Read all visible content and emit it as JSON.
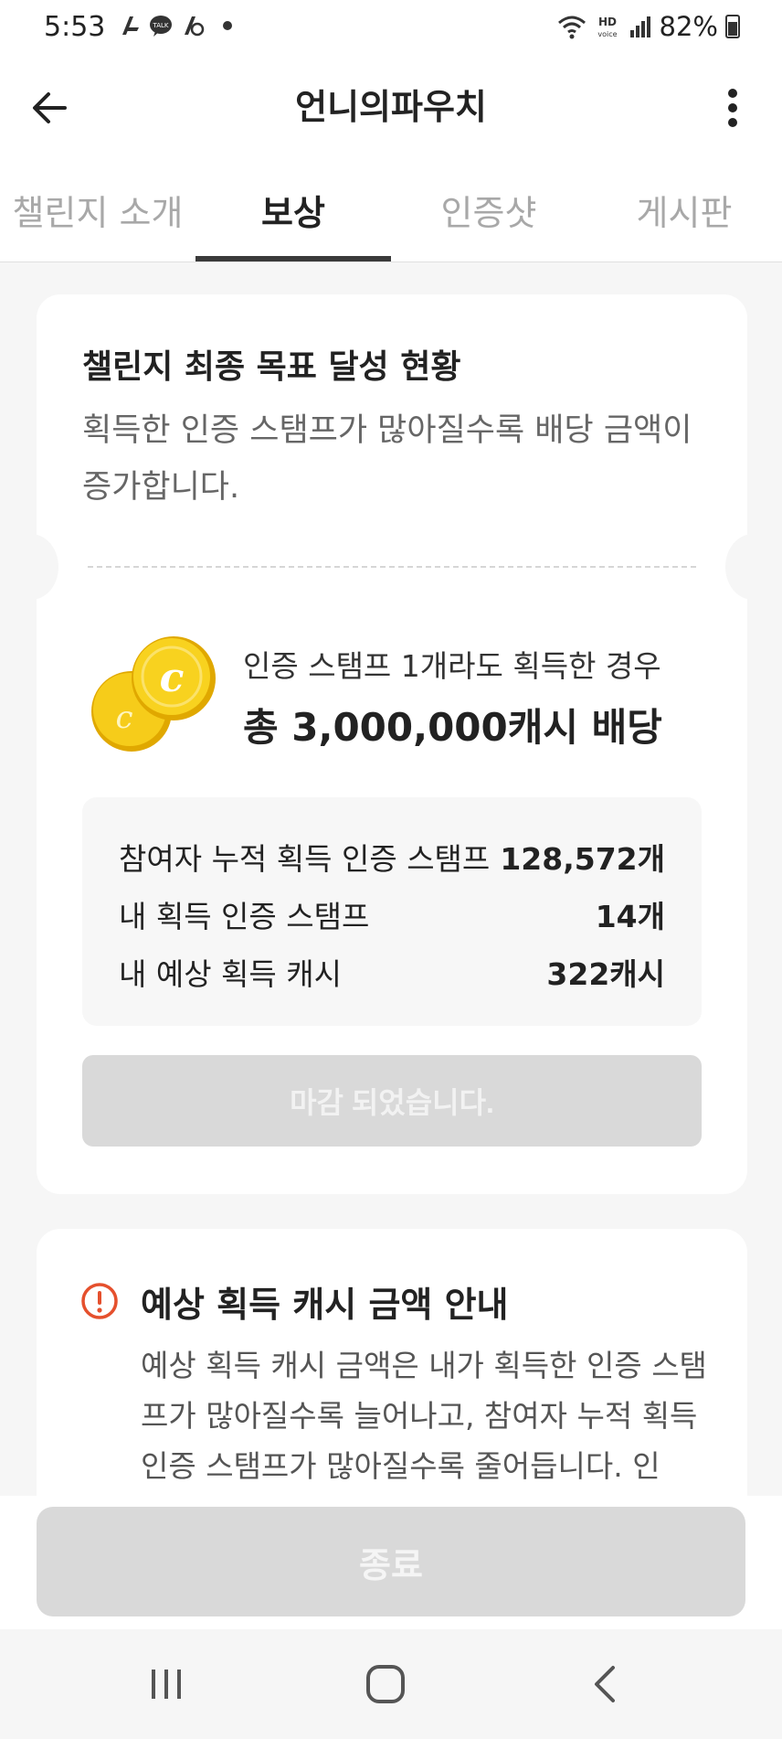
{
  "status_bar": {
    "time": "5:53",
    "battery": "82%",
    "icons": [
      "kakao-icon",
      "talk-icon",
      "kakao-page-icon",
      "dot",
      "wifi-icon",
      "hd-voice-icon",
      "signal-icon",
      "battery-icon"
    ]
  },
  "app_bar": {
    "title": "언니의파우치",
    "back_icon": "arrow-left-icon",
    "more_icon": "more-vertical-icon"
  },
  "tabs": [
    {
      "label": "챌린지 소개",
      "active": false
    },
    {
      "label": "보상",
      "active": true
    },
    {
      "label": "인증샷",
      "active": false
    },
    {
      "label": "게시판",
      "active": false
    }
  ],
  "goal_card": {
    "title": "챌린지 최종 목표 달성 현황",
    "description": "획득한 인증 스탬프가 많아질수록 배당 금액이 증가합니다.",
    "reward_condition": "인증 스탬프 1개라도 획득한 경우",
    "reward_amount": "총 3,000,000캐시 배당",
    "stats": [
      {
        "label": "참여자 누적 획득 인증 스탬프",
        "value": "128,572개"
      },
      {
        "label": "내 획득 인증 스탬프",
        "value": "14개"
      },
      {
        "label": "내 예상 획득 캐시",
        "value": "322캐시"
      }
    ],
    "closed_button": "마감 되었습니다."
  },
  "info_card": {
    "title": "예상 획득 캐시 금액 안내",
    "body": "예상 획득 캐시 금액은 내가 획득한 인증 스탬프가 많아질수록 늘어나고, 참여자 누적 획득 인증 스탬프가 많아질수록 줄어듭니다. 인"
  },
  "exit_button": "종료",
  "colors": {
    "accent_dark": "#3a3a3a",
    "disabled_button": "#d9d9d9",
    "alert_red": "#e5502d",
    "coin_yellow": "#f2c200"
  }
}
